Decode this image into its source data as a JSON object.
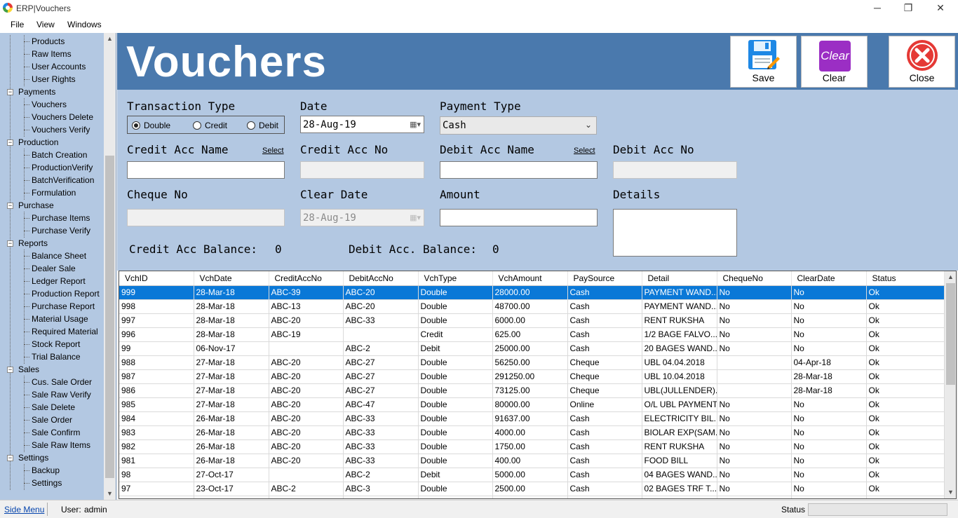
{
  "window": {
    "title": "ERP|Vouchers",
    "minimize": "─",
    "maximize": "❐",
    "close": "✕"
  },
  "menu": [
    "File",
    "View",
    "Windows"
  ],
  "sidebar": {
    "tree": [
      {
        "type": "leaf",
        "label": "Products"
      },
      {
        "type": "leaf",
        "label": "Raw Items"
      },
      {
        "type": "leaf",
        "label": "User Accounts"
      },
      {
        "type": "leaf",
        "label": "User Rights"
      },
      {
        "type": "group",
        "label": "Payments"
      },
      {
        "type": "leaf",
        "label": "Vouchers"
      },
      {
        "type": "leaf",
        "label": "Vouchers Delete"
      },
      {
        "type": "leaf",
        "label": "Vouchers Verify"
      },
      {
        "type": "group",
        "label": "Production"
      },
      {
        "type": "leaf",
        "label": "Batch Creation"
      },
      {
        "type": "leaf",
        "label": "ProductionVerify"
      },
      {
        "type": "leaf",
        "label": "BatchVerification"
      },
      {
        "type": "leaf",
        "label": "Formulation"
      },
      {
        "type": "group",
        "label": "Purchase"
      },
      {
        "type": "leaf",
        "label": "Purchase Items"
      },
      {
        "type": "leaf",
        "label": "Purchase Verify"
      },
      {
        "type": "group",
        "label": "Reports"
      },
      {
        "type": "leaf",
        "label": "Balance Sheet"
      },
      {
        "type": "leaf",
        "label": "Dealer Sale"
      },
      {
        "type": "leaf",
        "label": "Ledger Report"
      },
      {
        "type": "leaf",
        "label": "Production Report"
      },
      {
        "type": "leaf",
        "label": "Purchase Report"
      },
      {
        "type": "leaf",
        "label": "Material Usage"
      },
      {
        "type": "leaf",
        "label": "Required Material"
      },
      {
        "type": "leaf",
        "label": "Stock Report"
      },
      {
        "type": "leaf",
        "label": "Trial Balance"
      },
      {
        "type": "group",
        "label": "Sales"
      },
      {
        "type": "leaf",
        "label": "Cus. Sale Order"
      },
      {
        "type": "leaf",
        "label": "Sale Raw Verify"
      },
      {
        "type": "leaf",
        "label": "Sale Delete"
      },
      {
        "type": "leaf",
        "label": "Sale Order"
      },
      {
        "type": "leaf",
        "label": "Sale Confirm"
      },
      {
        "type": "leaf",
        "label": "Sale Raw Items"
      },
      {
        "type": "group",
        "label": "Settings"
      },
      {
        "type": "leaf",
        "label": "Backup"
      },
      {
        "type": "leaf",
        "label": "Settings"
      }
    ]
  },
  "header": {
    "title": "Vouchers",
    "save_label": "Save",
    "clear_label": "Clear",
    "clear_icon_text": "Clear",
    "close_label": "Close"
  },
  "form": {
    "transaction_type_label": "Transaction Type",
    "radio_double": "Double",
    "radio_credit": "Credit",
    "radio_debit": "Debit",
    "date_label": "Date",
    "date_value": "28-Aug-19",
    "payment_type_label": "Payment Type",
    "payment_type_value": "Cash",
    "credit_acc_name_label": "Credit Acc Name",
    "credit_select": "Select",
    "credit_acc_no_label": "Credit Acc No",
    "debit_acc_name_label": "Debit Acc Name",
    "debit_select": "Select",
    "debit_acc_no_label": "Debit Acc No",
    "cheque_no_label": "Cheque No",
    "clear_date_label": "Clear Date",
    "clear_date_value": "28-Aug-19",
    "amount_label": "Amount",
    "details_label": "Details",
    "credit_balance_label": "Credit Acc Balance:",
    "credit_balance_value": "0",
    "debit_balance_label": "Debit Acc. Balance:",
    "debit_balance_value": "0"
  },
  "grid": {
    "columns": [
      "VchID",
      "VchDate",
      "CreditAccNo",
      "DebitAccNo",
      "VchType",
      "VchAmount",
      "PaySource",
      "Detail",
      "ChequeNo",
      "ClearDate",
      "Status"
    ],
    "rows": [
      [
        "999",
        "28-Mar-18",
        "ABC-39",
        "ABC-20",
        "Double",
        "28000.00",
        "Cash",
        "PAYMENT WAND...",
        "No",
        "No",
        "Ok"
      ],
      [
        "998",
        "28-Mar-18",
        "ABC-13",
        "ABC-20",
        "Double",
        "48700.00",
        "Cash",
        "PAYMENT WAND...",
        "No",
        "No",
        "Ok"
      ],
      [
        "997",
        "28-Mar-18",
        "ABC-20",
        "ABC-33",
        "Double",
        "6000.00",
        "Cash",
        "RENT RUKSHA",
        "No",
        "No",
        "Ok"
      ],
      [
        "996",
        "28-Mar-18",
        "ABC-19",
        "",
        "Credit",
        "625.00",
        "Cash",
        "1/2 BAGE FALVO...",
        "No",
        "No",
        "Ok"
      ],
      [
        "99",
        "06-Nov-17",
        "",
        "ABC-2",
        "Debit",
        "25000.00",
        "Cash",
        "20 BAGES WAND...",
        "No",
        "No",
        "Ok"
      ],
      [
        "988",
        "27-Mar-18",
        "ABC-20",
        "ABC-27",
        "Double",
        "56250.00",
        "Cheque",
        "UBL 04.04.2018",
        "",
        "04-Apr-18",
        "Ok"
      ],
      [
        "987",
        "27-Mar-18",
        "ABC-20",
        "ABC-27",
        "Double",
        "291250.00",
        "Cheque",
        "UBL 10.04.2018",
        "",
        "28-Mar-18",
        "Ok"
      ],
      [
        "986",
        "27-Mar-18",
        "ABC-20",
        "ABC-27",
        "Double",
        "73125.00",
        "Cheque",
        "UBL(JULLENDER)...",
        "",
        "28-Mar-18",
        "Ok"
      ],
      [
        "985",
        "27-Mar-18",
        "ABC-20",
        "ABC-47",
        "Double",
        "80000.00",
        "Online",
        "O/L UBL PAYMENT",
        "No",
        "No",
        "Ok"
      ],
      [
        "984",
        "26-Mar-18",
        "ABC-20",
        "ABC-33",
        "Double",
        "91637.00",
        "Cash",
        "ELECTRICITY BIL...",
        "No",
        "No",
        "Ok"
      ],
      [
        "983",
        "26-Mar-18",
        "ABC-20",
        "ABC-33",
        "Double",
        "4000.00",
        "Cash",
        "BIOLAR EXP(SAM...",
        "No",
        "No",
        "Ok"
      ],
      [
        "982",
        "26-Mar-18",
        "ABC-20",
        "ABC-33",
        "Double",
        "1750.00",
        "Cash",
        "RENT RUKSHA",
        "No",
        "No",
        "Ok"
      ],
      [
        "981",
        "26-Mar-18",
        "ABC-20",
        "ABC-33",
        "Double",
        "400.00",
        "Cash",
        "FOOD BILL",
        "No",
        "No",
        "Ok"
      ],
      [
        "98",
        "27-Oct-17",
        "",
        "ABC-2",
        "Debit",
        "5000.00",
        "Cash",
        "04 BAGES WAND...",
        "No",
        "No",
        "Ok"
      ],
      [
        "97",
        "23-Oct-17",
        "ABC-2",
        "ABC-3",
        "Double",
        "2500.00",
        "Cash",
        "02 BAGES TRF T...",
        "No",
        "No",
        "Ok"
      ],
      [
        "",
        "",
        "",
        "",
        "",
        "",
        "",
        "",
        "",
        "",
        ""
      ]
    ]
  },
  "statusbar": {
    "side_menu": "Side Menu",
    "user_label": "User:",
    "user_value": "admin",
    "status_label": "Status"
  },
  "colors": {
    "header_blue": "#4a79ad",
    "panel_blue": "#b3c8e2",
    "selection": "#0a78d7",
    "clear_icon": "#9b2ec4",
    "close_icon": "#e53935"
  }
}
